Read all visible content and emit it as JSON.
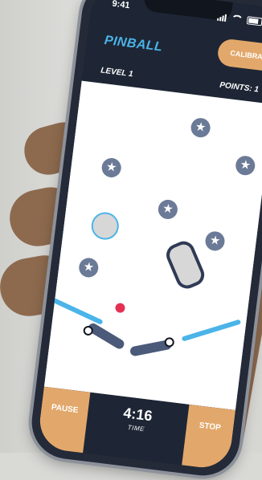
{
  "status_bar": {
    "time": "9:41"
  },
  "header": {
    "title": "PINBALL",
    "calibrate_label": "CALIBRATE",
    "level_text": "LEVEL 1",
    "points_text": "POINTS: 1"
  },
  "game": {
    "icons": {
      "star_bumper": "star-icon",
      "ball": "ball-icon"
    }
  },
  "footer": {
    "pause_label": "PAUSE",
    "time_value": "4:16",
    "time_label": "TIME",
    "stop_label": "STOP"
  },
  "colors": {
    "accent_blue": "#4BB4E8",
    "accent_orange": "#E2A86B",
    "dark_navy": "#1E2635",
    "ball_red": "#E53054",
    "bumper_slate": "#6B7A96"
  }
}
